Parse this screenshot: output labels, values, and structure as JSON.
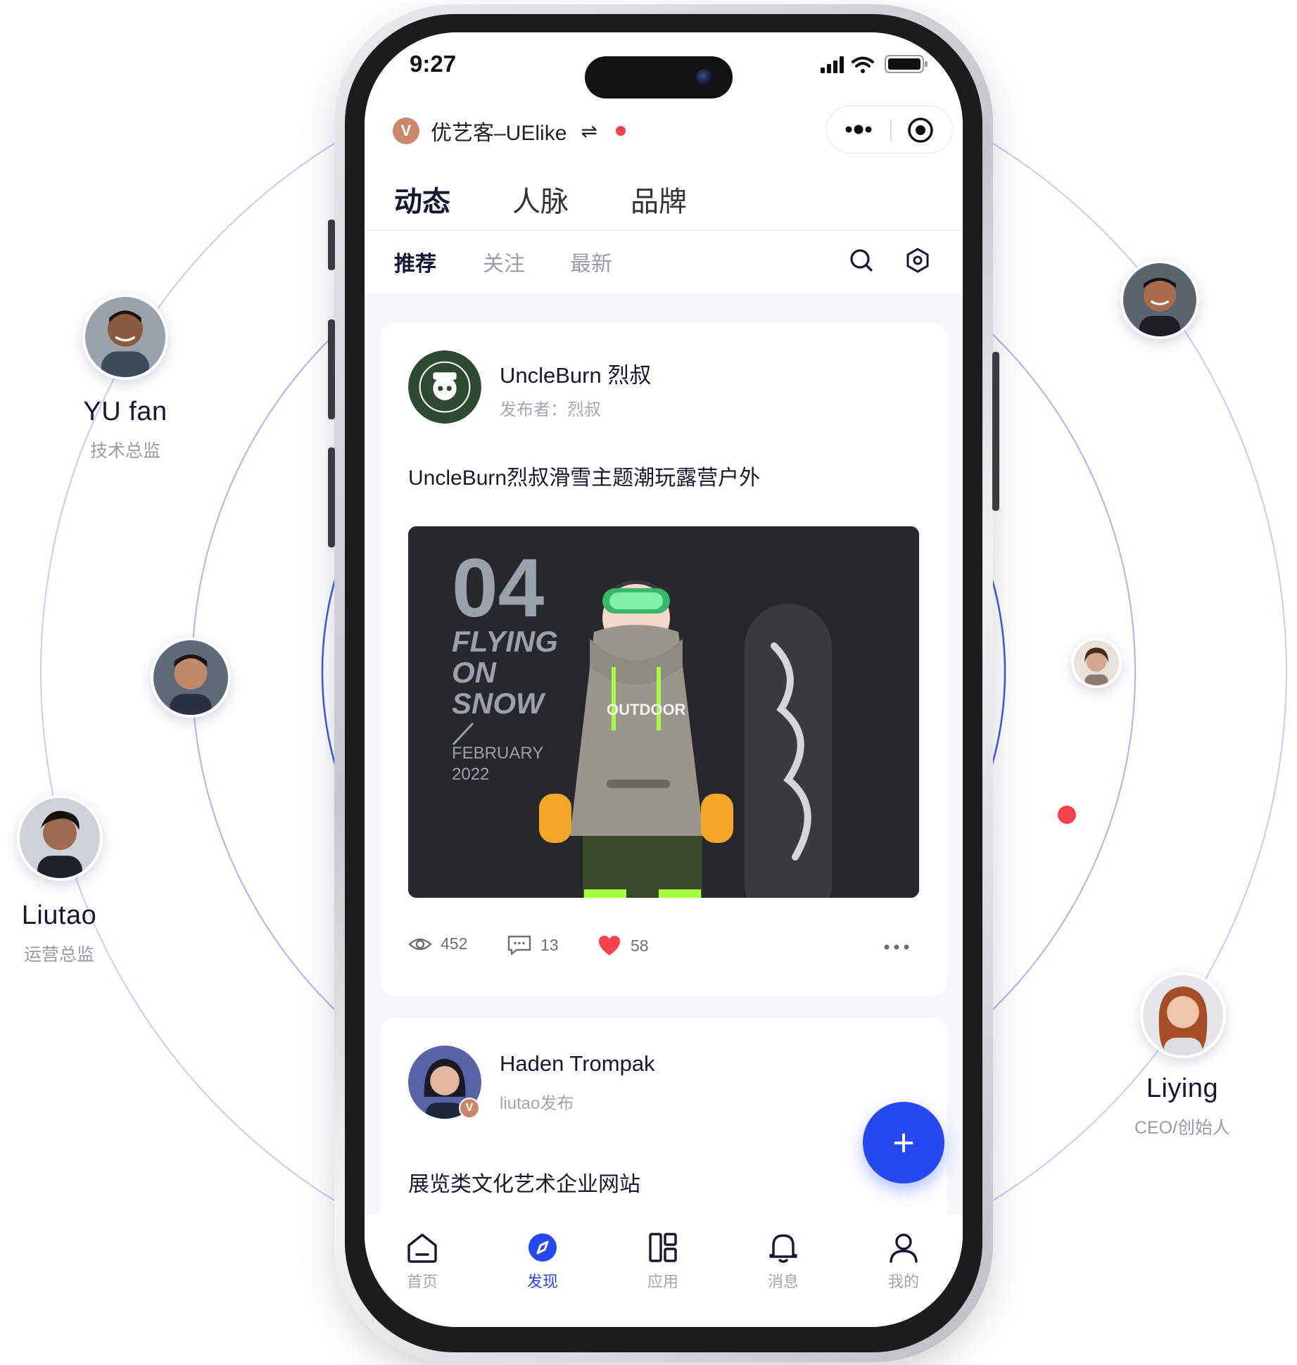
{
  "people": [
    {
      "name": "YU fan",
      "role": "技术总监",
      "avatar": "avatar-yufan"
    },
    {
      "name": "Liutao",
      "role": "运营总监",
      "avatar": "avatar-liutao"
    },
    {
      "name": "Liying",
      "role": "CEO/创始人",
      "avatar": "avatar-liying"
    }
  ],
  "status_bar": {
    "time": "9:27"
  },
  "app": {
    "logo_letter": "V",
    "name": "优艺客–UElike"
  },
  "main_tabs": [
    "动态",
    "人脉",
    "品牌"
  ],
  "sub_tabs": [
    "推荐",
    "关注",
    "最新"
  ],
  "posts": [
    {
      "author": "UncleBurn 烈叔",
      "meta": "发布者：烈叔",
      "text": "UncleBurn烈叔滑雪主题潮玩露营户外",
      "image_text": {
        "number": "04",
        "line1": "FLYING",
        "line2": "ON",
        "line3": "SNOW",
        "month": "FEBRUARY",
        "year": "2022",
        "hoodie": "OUTDOOR"
      },
      "views": "452",
      "comments": "13",
      "likes": "58"
    },
    {
      "author": "Haden Trompak",
      "meta": "liutao发布",
      "text": "展览类文化艺术企业网站",
      "badge": "V"
    }
  ],
  "fab_label": "+",
  "bottom_nav": [
    {
      "label": "首页",
      "icon": "home-icon"
    },
    {
      "label": "发现",
      "icon": "compass-icon",
      "active": true
    },
    {
      "label": "应用",
      "icon": "apps-icon"
    },
    {
      "label": "消息",
      "icon": "bell-icon"
    },
    {
      "label": "我的",
      "icon": "user-icon"
    }
  ],
  "colors": {
    "accent": "#2548f0",
    "red": "#f4424b",
    "orbit": "#b9c2f5",
    "orbit_inner": "#4a5ff0"
  }
}
